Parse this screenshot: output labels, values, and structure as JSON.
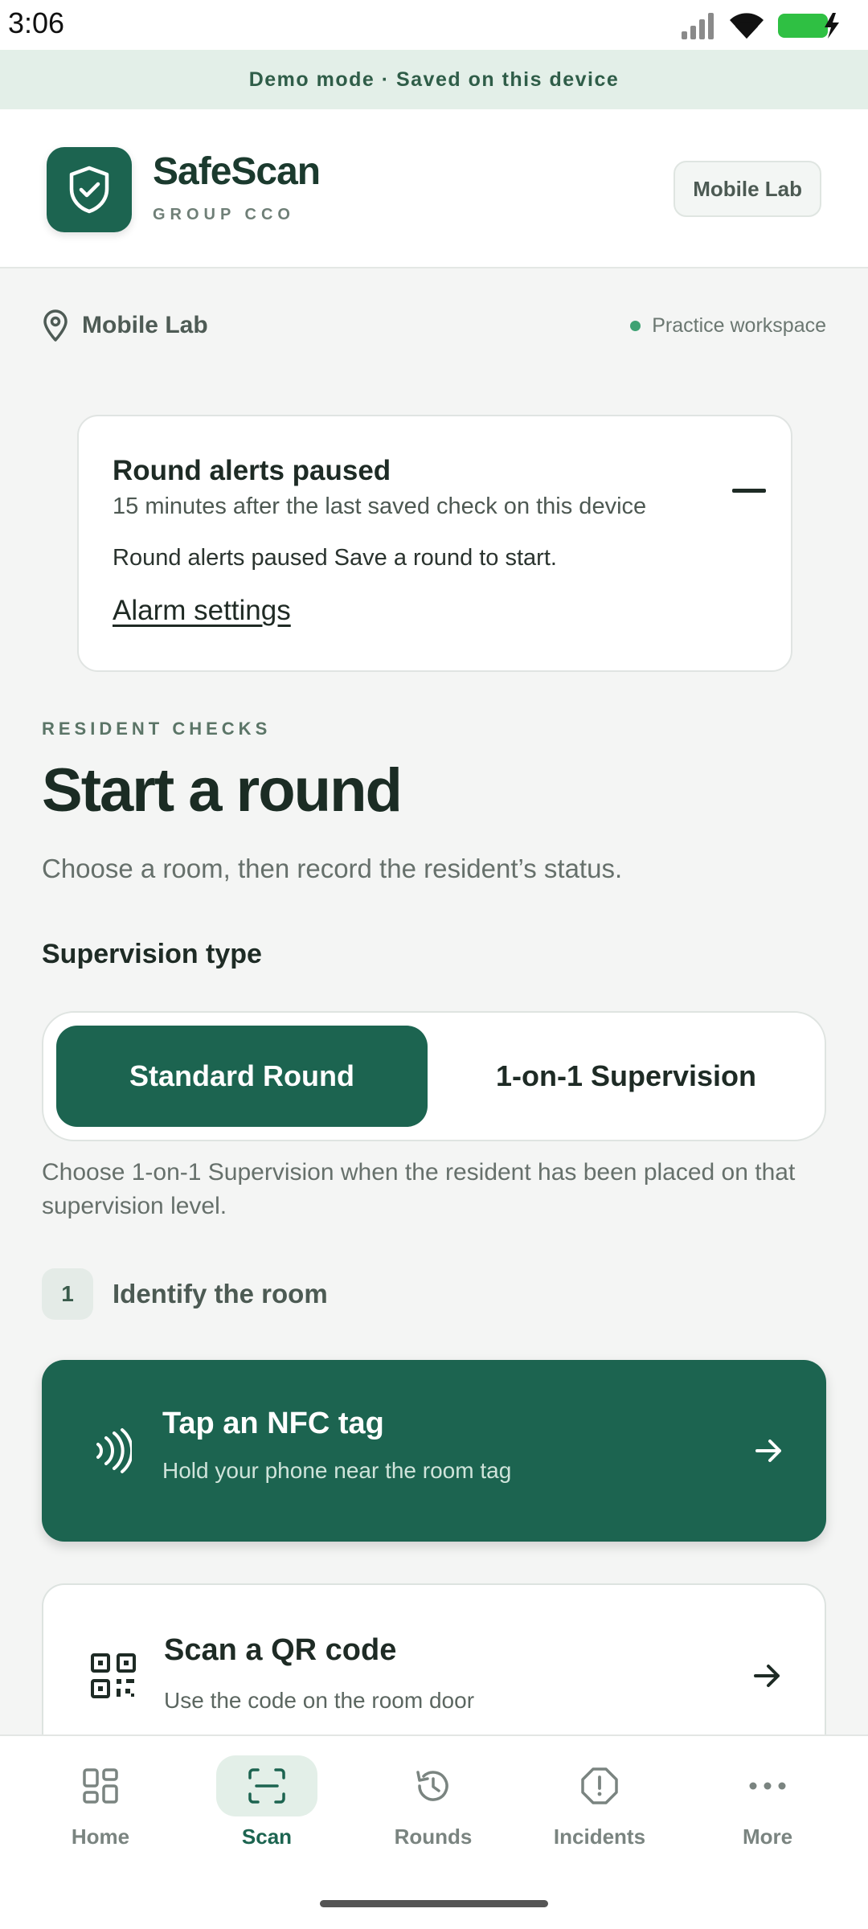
{
  "status_bar": {
    "time": "3:06"
  },
  "banner": {
    "text": "Demo mode · Saved on this device"
  },
  "header": {
    "brand": "SafeScan",
    "subtitle": "GROUP CCO",
    "workspace_chip": "Mobile Lab"
  },
  "location": {
    "name": "Mobile Lab",
    "mode": "Practice workspace"
  },
  "alert": {
    "title": "Round alerts paused",
    "subtitle": "15 minutes after the last saved check on this device",
    "message": "Round alerts paused Save a round to start.",
    "link": "Alarm settings"
  },
  "main": {
    "eyebrow": "RESIDENT CHECKS",
    "title": "Start a round",
    "lead": "Choose a room, then record the resident’s status.",
    "supervision_label": "Supervision type",
    "supervision_options": [
      {
        "label": "Standard Round",
        "selected": true
      },
      {
        "label": "1-on-1 Supervision",
        "selected": false
      }
    ],
    "helper": "Choose 1-on-1 Supervision when the resident has been placed on that supervision level.",
    "step": {
      "number": "1",
      "label": "Identify the room"
    },
    "actions": [
      {
        "title": "Tap an NFC tag",
        "subtitle": "Hold your phone near the room tag",
        "icon": "nfc-icon"
      },
      {
        "title": "Scan a QR code",
        "subtitle": "Use the code on the room door",
        "icon": "qr-code-icon"
      }
    ]
  },
  "nav": {
    "items": [
      {
        "label": "Home",
        "icon": "home-grid-icon",
        "active": false
      },
      {
        "label": "Scan",
        "icon": "scan-icon",
        "active": true
      },
      {
        "label": "Rounds",
        "icon": "history-icon",
        "active": false
      },
      {
        "label": "Incidents",
        "icon": "alert-octagon-icon",
        "active": false
      },
      {
        "label": "More",
        "icon": "more-dots-icon",
        "active": false
      }
    ]
  },
  "colors": {
    "brand": "#1c6450",
    "banner_bg": "#e3efe8",
    "practice_dot": "#3ea273"
  }
}
